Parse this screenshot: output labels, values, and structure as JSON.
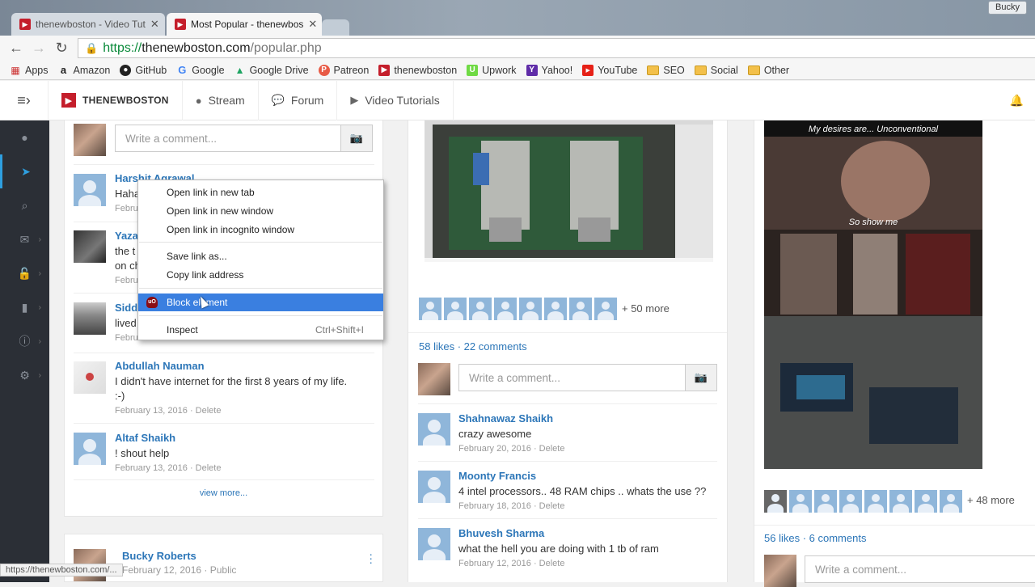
{
  "browser": {
    "tabs": [
      {
        "title": "thenewboston - Video Tut"
      },
      {
        "title": "Most Popular - thenewbos"
      }
    ],
    "user": "Bucky",
    "url": {
      "scheme": "https://",
      "host": "thenewboston.com",
      "path": "/popular.php"
    },
    "bookmarks": [
      "Apps",
      "Amazon",
      "GitHub",
      "Google",
      "Google Drive",
      "Patreon",
      "thenewboston",
      "Upwork",
      "Yahoo!",
      "YouTube",
      "SEO",
      "Social",
      "Other"
    ],
    "status_url": "https://thenewboston.com/..."
  },
  "site": {
    "brand": "THENEWBOSTON",
    "nav": [
      "Stream",
      "Forum",
      "Video Tutorials"
    ]
  },
  "col1": {
    "comment_placeholder": "Write a comment...",
    "comments": [
      {
        "name": "Harshit Agrawal",
        "text": "Haha",
        "date": "February"
      },
      {
        "name": "Yazan",
        "text": "the t",
        "text2": "on ch",
        "date": "Febru"
      },
      {
        "name": "Siddi",
        "text": "lived",
        "date": "Febru"
      },
      {
        "name": "Abdullah Nauman",
        "text": "I didn't have internet for the first 8 years of my life.",
        "text2": ":-)",
        "date": "February 13, 2016 · Delete"
      },
      {
        "name": "Altaf Shaikh",
        "text": "! shout help",
        "date": "February 13, 2016 · Delete"
      }
    ],
    "view_more": "view more...",
    "next_post": {
      "name": "Bucky Roberts",
      "date": "February 12, 2016 · Public"
    }
  },
  "col2": {
    "more": "+ 50 more",
    "likes": "58 likes",
    "comments_count": "22 comments",
    "comment_placeholder": "Write a comment...",
    "comments": [
      {
        "name": "Shahnawaz Shaikh",
        "text": "crazy awesome",
        "date": "February 20, 2016 · Delete"
      },
      {
        "name": "Moonty Francis",
        "text": "4 intel processors.. 48 RAM chips .. whats the use ??",
        "date": "February 18, 2016 · Delete"
      },
      {
        "name": "Bhuvesh Sharma",
        "text": "what the hell you are doing with 1 tb of ram",
        "date": "February 12, 2016 · Delete"
      }
    ]
  },
  "col3": {
    "meme_top": "My desires are... Unconventional",
    "meme_mid": "So show me",
    "more": "+ 48 more",
    "likes": "56 likes",
    "comments_count": "6 comments",
    "comment_placeholder": "Write a comment..."
  },
  "context_menu": {
    "items": [
      "Open link in new tab",
      "Open link in new window",
      "Open link in incognito window",
      "Save link as...",
      "Copy link address",
      "Block element",
      "Inspect"
    ],
    "inspect_shortcut": "Ctrl+Shift+I"
  }
}
